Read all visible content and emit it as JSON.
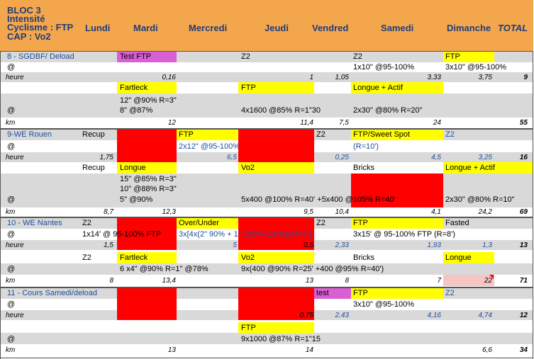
{
  "header": {
    "title_lines": [
      "BLOC 3",
      "Intensité",
      "Cyclisme : FTP",
      "CAP : Vo2"
    ],
    "days": [
      "Lundi",
      "Mardi",
      "Mercredi",
      "Jeudi",
      "Vendred",
      "Samedi",
      "Dimanche"
    ],
    "total": "TOTAL"
  },
  "colors": {
    "header_bg": "#f4a64c",
    "yellow": "#ffff00",
    "red": "#ff0000",
    "purple": "#d95fd4",
    "grey": "#d9d9d9",
    "pink": "#f7c4c4",
    "blue_text": "#1f4e9a"
  },
  "units": {
    "at": "@",
    "hour": "heure",
    "km": "km"
  },
  "weeks": [
    {
      "label": "8 - SGDBF/ Deload",
      "bike": {
        "labels": [
          "Test FTP",
          "Z2",
          "Z2",
          "FTP"
        ],
        "details": [
          "1x10\" @95-100%",
          "3x10\" @95-100%"
        ],
        "hours": [
          "0,16",
          "1",
          "1,05",
          "3,33",
          "3,75"
        ],
        "total_hours": "9"
      },
      "run": {
        "labels": [
          "Fartleck",
          "FTP",
          "Longue + Actif"
        ],
        "details": [
          "12\" @90% R=3\"",
          "8\" @87%",
          "4x1600 @85% R=1\"30",
          "2x30\" @80% R=20\""
        ],
        "km": [
          "12",
          "11,4",
          "7,5",
          "24"
        ],
        "total_km": "55"
      }
    },
    {
      "label": "9-WE Rouen",
      "bike": {
        "labels": [
          "Recup",
          "FTP",
          "Z2",
          "FTP/Sweet Spot",
          "Z2"
        ],
        "details": [
          "2x12\" @95-100%",
          "(R=10')"
        ],
        "hours": [
          "1,75",
          "6,5",
          "0,25",
          "4,5",
          "3,25"
        ],
        "total_hours": "16"
      },
      "run": {
        "labels": [
          "Recup",
          "Longue",
          "Vo2",
          "Bricks",
          "Longue + Actif"
        ],
        "details": [
          "15\" @85% R=3\"",
          "10\" @88% R=3\"",
          "5\" @90%",
          "5x400 @100% R=40' +5x400 @105% R=40'",
          "2x30\" @80% R=10\""
        ],
        "km": [
          "8,7",
          "12,3",
          "9,5",
          "10,4",
          "4,1",
          "24,2"
        ],
        "total_km": "69"
      }
    },
    {
      "label": "10 - WE Nantes",
      "bike": {
        "labels": [
          "Z2",
          "Over/Under",
          "Z2",
          "FTP",
          "Fasted"
        ],
        "details": [
          "1x14' @ 95-100% FTP",
          "3x[4x(2\" 90% + 1\" 105%-110%)] R=3\"]",
          "3x15' @ 95-100% FTP (R=8')"
        ],
        "hours": [
          "1,5",
          "5",
          "0,5",
          "2,33",
          "1,93",
          "1,3"
        ],
        "total_hours": "13"
      },
      "run": {
        "labels": [
          "Z2",
          "Fartleck",
          "Vo2",
          "Bricks",
          "Longue"
        ],
        "details": [
          "6 x4\" @90% R=1\" @78%",
          "9x(400 @90% R=25' +400 @95% R=40')"
        ],
        "km": [
          "8",
          "13,4",
          "13",
          "8",
          "7",
          "22"
        ],
        "total_km": "71"
      }
    },
    {
      "label": "11 - Cours Samedi/deload",
      "bike": {
        "labels": [
          "test",
          "FTP",
          "Z2"
        ],
        "details": [
          "3x10\" @95-100%"
        ],
        "hours": [
          "0,75",
          "2,43",
          "4,16",
          "4,74"
        ],
        "total_hours": "12"
      },
      "run": {
        "labels": [
          "FTP"
        ],
        "details": [
          "9x1000 @87% R=1\"15"
        ],
        "km": [
          "13",
          "14",
          "6,6"
        ],
        "total_km": "34"
      }
    }
  ]
}
